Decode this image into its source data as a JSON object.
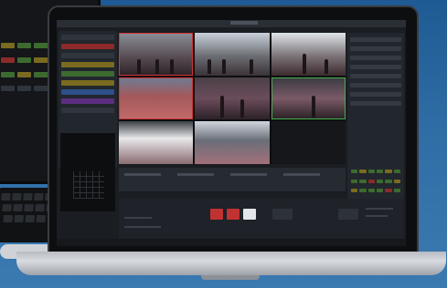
{
  "background": {
    "color": "#2f6da6"
  },
  "app": {
    "accent_red": "#c13232",
    "accent_green": "#43b04a",
    "tiles": [
      {
        "name": "multiview-tile-1",
        "tally": "red"
      },
      {
        "name": "multiview-tile-2",
        "tally": "none"
      },
      {
        "name": "multiview-tile-3",
        "tally": "none"
      },
      {
        "name": "multiview-tile-4",
        "tally": "red"
      },
      {
        "name": "multiview-tile-5",
        "tally": "none"
      },
      {
        "name": "multiview-tile-6",
        "tally": "green"
      },
      {
        "name": "multiview-tile-7",
        "tally": "none"
      },
      {
        "name": "multiview-tile-8",
        "tally": "none"
      },
      {
        "name": "multiview-tile-9",
        "tally": "none"
      }
    ]
  }
}
